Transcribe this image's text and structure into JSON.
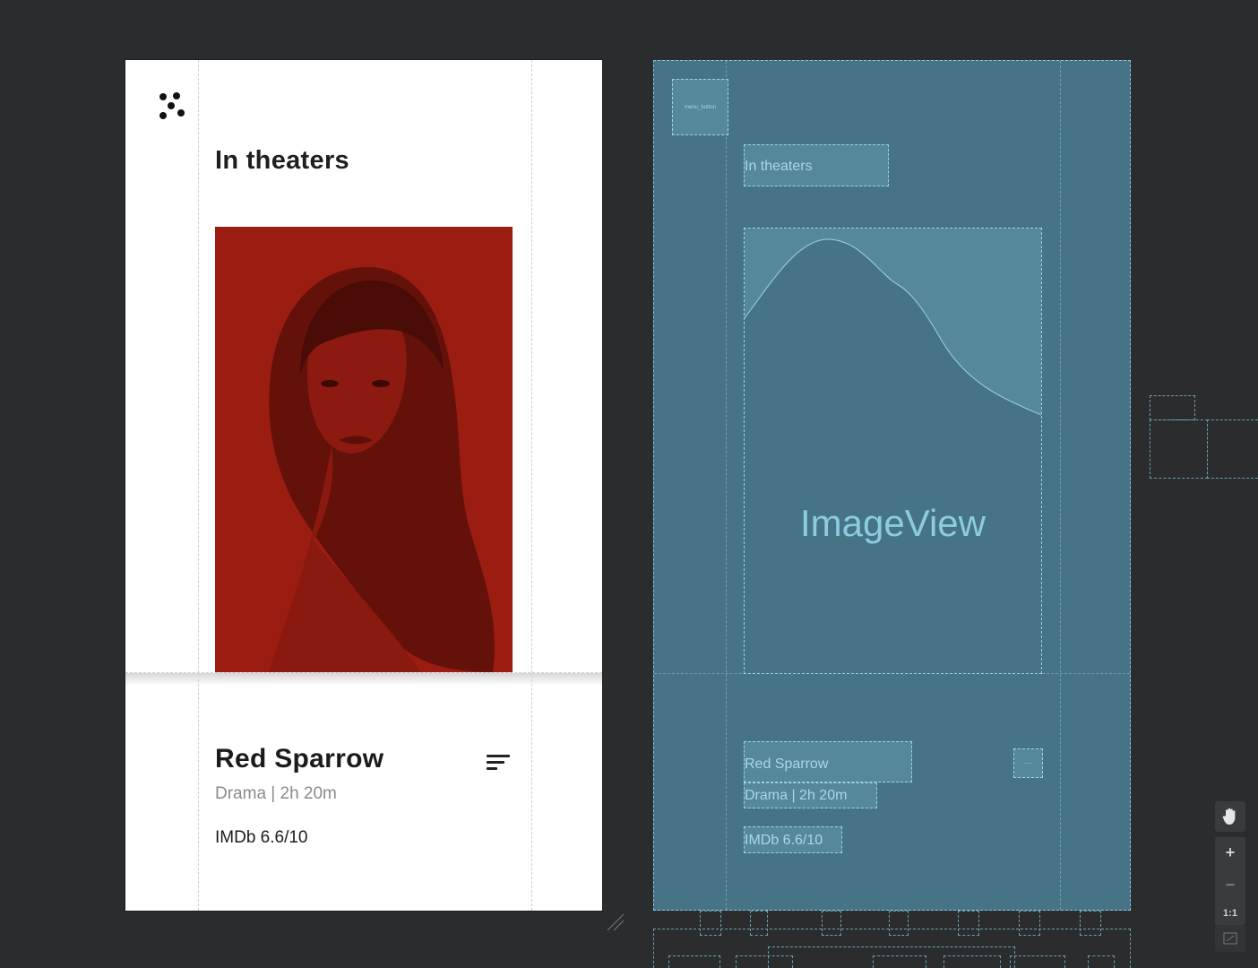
{
  "design": {
    "header_title": "In theaters",
    "movie": {
      "title": "Red Sparrow",
      "meta": "Drama | 2h 20m",
      "rating": "IMDb 6.6/10"
    },
    "poster_color": "#9b1d12"
  },
  "blueprint": {
    "menu_label": "menu_button",
    "header_title": "In theaters",
    "image_label": "ImageView",
    "movie_title": "Red Sparrow",
    "movie_meta": "Drama | 2h 20m",
    "rating": "IMDb 6.6/10",
    "sort_label": "------",
    "fill_color": "#467486",
    "border_color": "#9fd2e3"
  },
  "zoom_controls": {
    "pan": "pan-hand-icon",
    "zoom_in": "+",
    "zoom_out": "−",
    "actual_size": "1:1",
    "fit": "fit-screen-icon"
  }
}
